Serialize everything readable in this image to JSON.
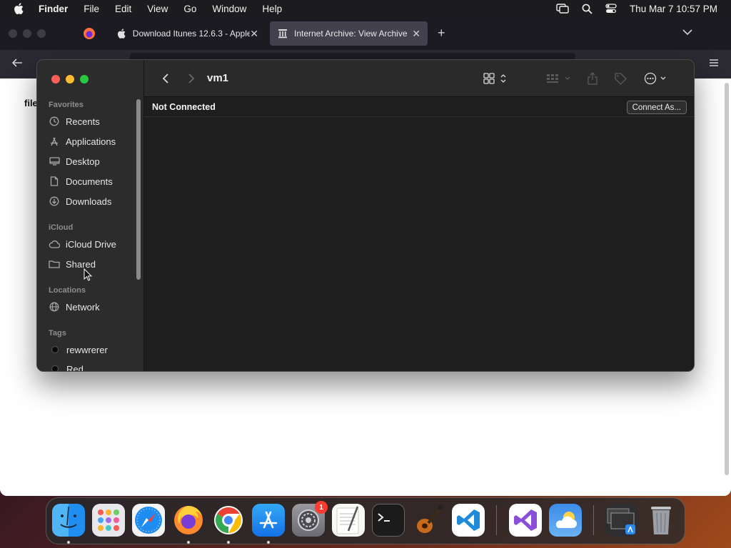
{
  "menubar": {
    "app_name": "Finder",
    "menus": [
      "File",
      "Edit",
      "View",
      "Go",
      "Window",
      "Help"
    ],
    "datetime": "Thu Mar 7  10:57 PM"
  },
  "browser": {
    "tabs": [
      {
        "title": "Download Itunes 12.6.3 - Apple",
        "icon": "apple-icon",
        "active": false
      },
      {
        "title": "Internet Archive: View Archive",
        "icon": "archive-icon",
        "active": true
      }
    ],
    "page_fragment": "file"
  },
  "finder": {
    "title": "vm1",
    "status": "Not Connected",
    "connect_button": "Connect As...",
    "sidebar": {
      "favorites_title": "Favorites",
      "favorites": [
        {
          "label": "Recents",
          "icon": "clock-icon"
        },
        {
          "label": "Applications",
          "icon": "applications-icon"
        },
        {
          "label": "Desktop",
          "icon": "desktop-icon"
        },
        {
          "label": "Documents",
          "icon": "document-icon"
        },
        {
          "label": "Downloads",
          "icon": "download-icon"
        }
      ],
      "icloud_title": "iCloud",
      "icloud": [
        {
          "label": "iCloud Drive",
          "icon": "cloud-icon"
        },
        {
          "label": "Shared",
          "icon": "shared-folder-icon"
        }
      ],
      "locations_title": "Locations",
      "locations": [
        {
          "label": "Network",
          "icon": "globe-icon"
        }
      ],
      "tags_title": "Tags",
      "tags": [
        {
          "label": "rewwrerer"
        },
        {
          "label": "Red"
        }
      ]
    }
  },
  "dock": {
    "apps": [
      "Finder",
      "Launchpad",
      "Safari",
      "Firefox",
      "Chrome",
      "App Store",
      "System Settings",
      "TextEdit",
      "Terminal",
      "GarageBand",
      "Visual Studio Code",
      "Visual Studio",
      "Weather",
      "Downloads Stack",
      "Trash"
    ],
    "system_settings_badge": "1"
  },
  "colors": {
    "close": "#ff5f57",
    "minimize": "#febc2e",
    "zoom": "#28c840",
    "finder_bg": "#1e1e1e",
    "sidebar_bg": "#2c2c2d"
  }
}
